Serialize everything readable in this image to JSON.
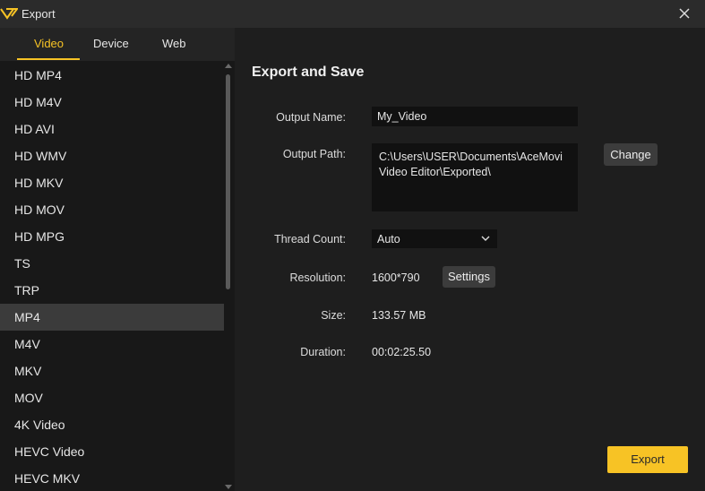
{
  "window": {
    "title": "Export",
    "logo_icon": "acemovi-logo-icon",
    "close_icon": "close-icon",
    "accent_color": "#f7c325"
  },
  "tabs": [
    {
      "label": "Video",
      "active": true
    },
    {
      "label": "Device",
      "active": false
    },
    {
      "label": "Web",
      "active": false
    }
  ],
  "formats": [
    {
      "label": "HD MP4"
    },
    {
      "label": "HD M4V"
    },
    {
      "label": "HD AVI"
    },
    {
      "label": "HD WMV"
    },
    {
      "label": "HD MKV"
    },
    {
      "label": "HD MOV"
    },
    {
      "label": "HD MPG"
    },
    {
      "label": "TS"
    },
    {
      "label": "TRP"
    },
    {
      "label": "MP4",
      "selected": true
    },
    {
      "label": "M4V"
    },
    {
      "label": "MKV"
    },
    {
      "label": "MOV"
    },
    {
      "label": "4K Video"
    },
    {
      "label": "HEVC Video"
    },
    {
      "label": "HEVC MKV"
    }
  ],
  "export": {
    "title": "Export and Save",
    "output_name_label": "Output Name:",
    "output_name_value": "My_Video",
    "output_path_label": "Output Path:",
    "output_path_value": "C:\\Users\\USER\\Documents\\AceMovi Video Editor\\Exported\\",
    "change_label": "Change",
    "thread_count_label": "Thread Count:",
    "thread_count_value": "Auto",
    "resolution_label": "Resolution:",
    "resolution_value": "1600*790",
    "settings_label": "Settings",
    "size_label": "Size:",
    "size_value": "133.57 MB",
    "duration_label": "Duration:",
    "duration_value": "00:02:25.50",
    "export_button_label": "Export"
  }
}
